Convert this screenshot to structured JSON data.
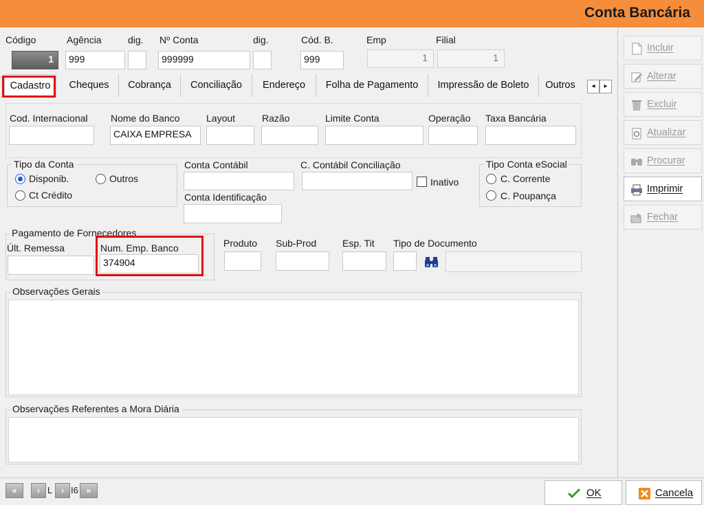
{
  "window": {
    "title": "Conta Bancária"
  },
  "header": {
    "codigo_label": "Código",
    "codigo_value": "1",
    "agencia_label": "Agência",
    "agencia_value": "999",
    "dig1_label": "dig.",
    "dig1_value": "",
    "conta_label": "Nº Conta",
    "conta_value": "999999",
    "dig2_label": "dig.",
    "dig2_value": "",
    "codb_label": "Cód. B.",
    "codb_value": "999",
    "emp_label": "Emp",
    "emp_value": "1",
    "filial_label": "Filial",
    "filial_value": "1"
  },
  "tabs": [
    "Cadastro",
    "Cheques",
    "Cobrança",
    "Conciliação",
    "Endereço",
    "Folha de Pagamento",
    "Impressão de Boleto",
    "Outros"
  ],
  "tab_scroll": {
    "left": "◂",
    "right": "▸"
  },
  "fields": {
    "cod_internacional_label": "Cod. Internacional",
    "cod_internacional_value": "",
    "nome_banco_label": "Nome do Banco",
    "nome_banco_value": "CAIXA EMPRESA",
    "layout_label": "Layout",
    "layout_value": "",
    "razao_label": "Razão",
    "razao_value": "",
    "limite_conta_label": "Limite Conta",
    "limite_conta_value": "",
    "operacao_label": "Operação",
    "operacao_value": "",
    "taxa_bancaria_label": "Taxa Bancária",
    "taxa_bancaria_value": ""
  },
  "tipo_conta": {
    "title": "Tipo da Conta",
    "options": [
      "Disponib.",
      "Outros",
      "Ct Crédito"
    ],
    "selected": "Disponib."
  },
  "contabil": {
    "conta_contabil_label": "Conta Contábil",
    "conta_contabil_value": "",
    "cont_conciliacao_label": "C. Contábil Conciliação",
    "cont_conciliacao_value": "",
    "inativo_label": "Inativo",
    "conta_identificacao_label": "Conta Identificação",
    "conta_identificacao_value": ""
  },
  "tipo_esocial": {
    "title": "Tipo Conta eSocial",
    "options": [
      "C. Corrente",
      "C. Poupança"
    ]
  },
  "pagamento": {
    "title": "Pagamento de Fornecedores",
    "ult_remessa_label": "Últ. Remessa",
    "ult_remessa_value": "",
    "num_emp_banco_label": "Num. Emp. Banco",
    "num_emp_banco_value": "374904"
  },
  "produto": {
    "produto_label": "Produto",
    "subprod_label": "Sub-Prod",
    "esp_tit_label": "Esp. Tit",
    "tipo_doc_label": "Tipo de Documento"
  },
  "observacoes": {
    "gerais_title": "Observações Gerais",
    "mora_title": "Observações Referentes a Mora Diária"
  },
  "sidebar": {
    "incluir": "Incluir",
    "alterar": "Alterar",
    "excluir": "Excluir",
    "atualizar": "Atualizar",
    "procurar": "Procurar",
    "imprimir": "Imprimir",
    "fechar": "Fechar"
  },
  "footer": {
    "nav_text_left": "L",
    "nav_text_right": "I6",
    "ok": "OK",
    "cancelar": "Cancela"
  },
  "colors": {
    "titlebar": "#f68d3b",
    "highlight": "#e01010",
    "radio": "#1a5fd1"
  }
}
